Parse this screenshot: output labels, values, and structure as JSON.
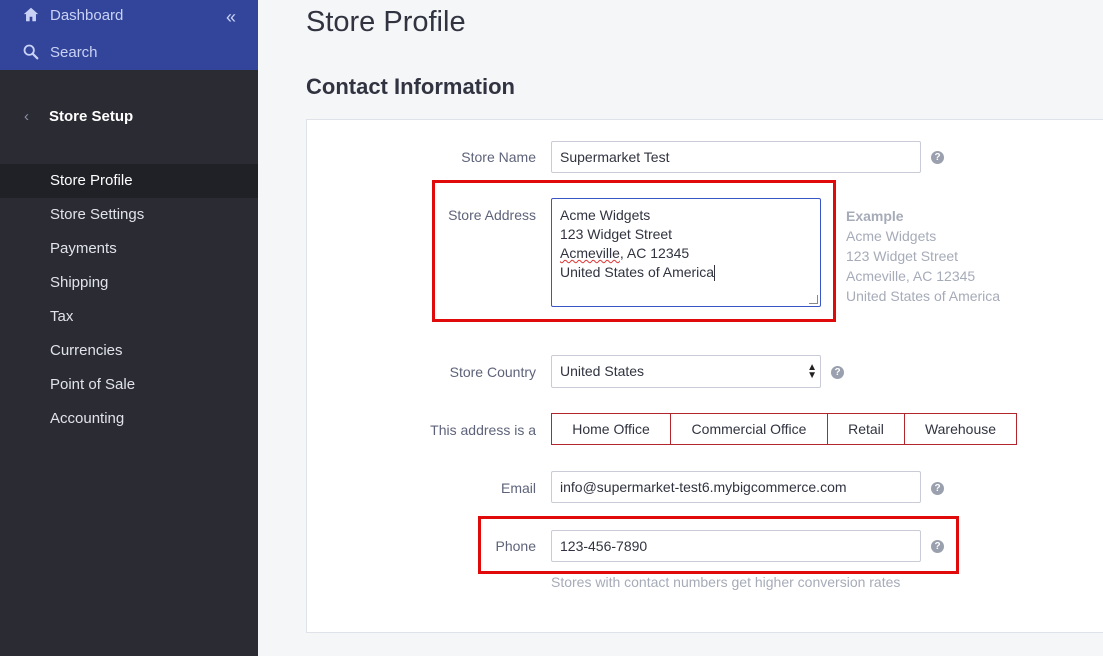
{
  "sidebar": {
    "dashboard": "Dashboard",
    "search": "Search",
    "collapse": "«",
    "section_title": "Store Setup",
    "items": [
      {
        "label": "Store Profile",
        "active": true
      },
      {
        "label": "Store Settings"
      },
      {
        "label": "Payments"
      },
      {
        "label": "Shipping"
      },
      {
        "label": "Tax"
      },
      {
        "label": "Currencies"
      },
      {
        "label": "Point of Sale"
      },
      {
        "label": "Accounting"
      }
    ]
  },
  "main": {
    "page_title": "Store Profile",
    "section_title": "Contact Information",
    "store_name": {
      "label": "Store Name",
      "value": "Supermarket Test"
    },
    "store_address": {
      "label": "Store Address",
      "lines": [
        "Acme Widgets",
        "123 Widget Street",
        "Acmeville",
        ", AC 12345",
        "United States of America"
      ]
    },
    "example": {
      "heading": "Example",
      "lines": [
        "Acme Widgets",
        "123 Widget Street",
        "Acmeville, AC 12345",
        "United States of America"
      ]
    },
    "store_country": {
      "label": "Store Country",
      "value": "United States"
    },
    "address_type": {
      "label": "This address is a",
      "options": [
        "Home Office",
        "Commercial Office",
        "Retail",
        "Warehouse"
      ]
    },
    "email": {
      "label": "Email",
      "value": "info@supermarket-test6.mybigcommerce.com"
    },
    "phone": {
      "label": "Phone",
      "value": "123-456-7890",
      "hint": "Stores with contact numbers get higher conversion rates"
    },
    "help_glyph": "?"
  },
  "colors": {
    "sidebar_top": "#33459a",
    "sidebar": "#2a2b33",
    "highlight": "#e10a0a"
  }
}
